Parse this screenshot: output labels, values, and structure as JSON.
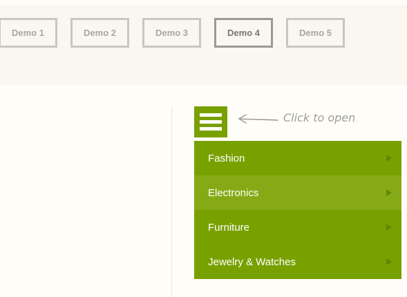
{
  "demos": [
    {
      "label": "Demo 1",
      "active": false
    },
    {
      "label": "Demo 2",
      "active": false
    },
    {
      "label": "Demo 3",
      "active": false
    },
    {
      "label": "Demo 4",
      "active": true
    },
    {
      "label": "Demo 5",
      "active": false
    }
  ],
  "annotation": {
    "text": "Click to open"
  },
  "menu": {
    "items": [
      {
        "label": "Fashion"
      },
      {
        "label": "Electronics"
      },
      {
        "label": "Furniture"
      },
      {
        "label": "Jewelry & Watches"
      }
    ]
  },
  "colors": {
    "accent": "#78a100",
    "accent_hover": "#86aa16",
    "background": "#fffdf8",
    "demo_bar": "#faf7f0"
  },
  "icons": {
    "menu": "hamburger-icon",
    "submenu": "chevron-right-icon",
    "annotation": "arrow-left-icon"
  }
}
